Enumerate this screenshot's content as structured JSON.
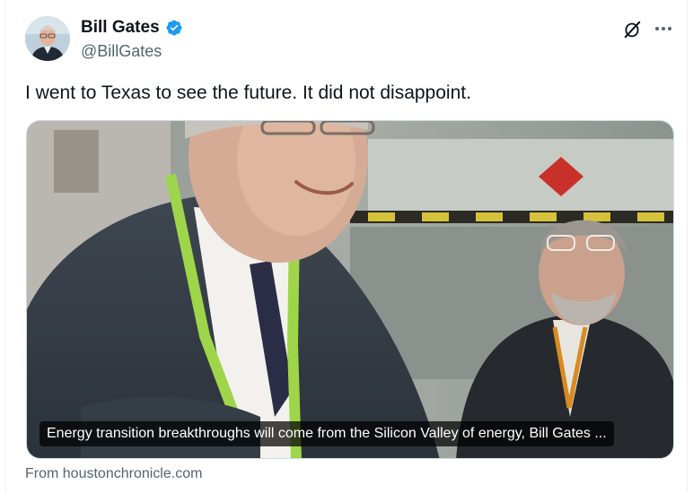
{
  "author": {
    "display_name": "Bill Gates",
    "handle": "@BillGates",
    "verified": true,
    "verified_color": "#1d9bf0",
    "avatar_icon": "profile-photo"
  },
  "actions": {
    "grok_icon": "grok-icon",
    "more_icon": "more-icon"
  },
  "tweet": {
    "text": "I went to Texas to see the future. It did not disappoint."
  },
  "link_card": {
    "caption": "Energy transition breakthroughs will come from the Silicon Valley of energy, Bill Gates ...",
    "source": "From houstonchronicle.com"
  }
}
